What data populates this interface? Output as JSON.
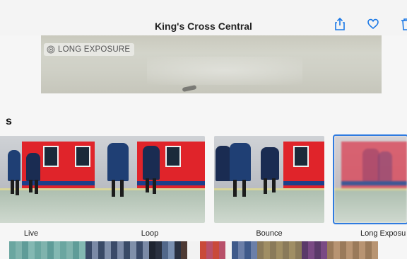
{
  "header": {
    "title": "King's Cross Central",
    "icons": [
      "share-icon",
      "heart-icon",
      "trash-icon"
    ]
  },
  "main_photo": {
    "badge_label": "LONG EXPOSURE",
    "badge_icon": "long-exposure-icon"
  },
  "section": {
    "title_fragment": "s"
  },
  "effects": [
    {
      "label": "Live",
      "selected": false
    },
    {
      "label": "Loop",
      "selected": false
    },
    {
      "label": "Bounce",
      "selected": false
    },
    {
      "label": "Long Exposu",
      "selected": true
    }
  ],
  "colors": {
    "accent": "#2f7be0",
    "icon_blue": "#1a78e6",
    "train_red": "#e0242a"
  }
}
